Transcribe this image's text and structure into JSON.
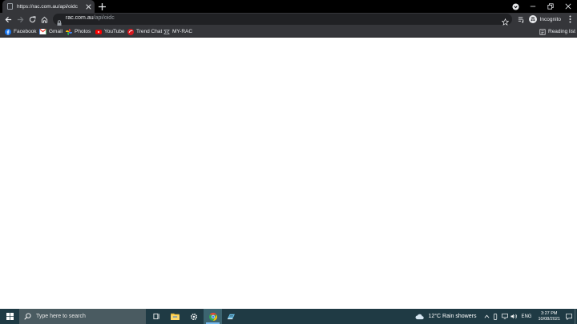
{
  "browser": {
    "tab": {
      "title": "https://rac.com.au/api/oidc"
    },
    "omnibox": {
      "host": "rac.com.au",
      "path": "/api/oidc"
    },
    "profile": {
      "label": "Incognito"
    },
    "bookmarks": [
      {
        "label": "Facebook",
        "icon": "facebook-icon"
      },
      {
        "label": "Gmail",
        "icon": "gmail-icon"
      },
      {
        "label": "Photos",
        "icon": "photos-icon"
      },
      {
        "label": "YouTube",
        "icon": "youtube-icon"
      },
      {
        "label": "Trend Chat",
        "icon": "trend-chat-icon"
      },
      {
        "label": "MY-RAC",
        "icon": "rac-icon"
      }
    ],
    "reading_list": {
      "label": "Reading list"
    }
  },
  "taskbar": {
    "search_placeholder": "Type here to search",
    "weather": "12°C  Rain showers",
    "language": "ENG",
    "time": "3:27 PM",
    "date": "10/08/2021"
  },
  "colors": {
    "titlebar": "#000000",
    "toolbar": "#35363a",
    "omnibox": "#202124",
    "taskbar": "#1f3a44"
  }
}
